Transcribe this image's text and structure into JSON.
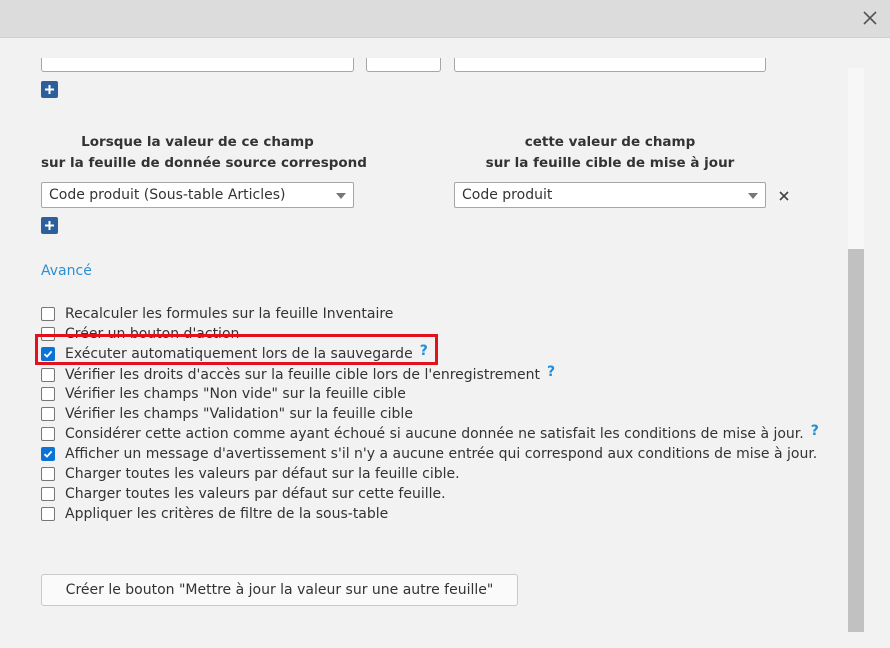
{
  "section_headers": {
    "source_line1": "Lorsque la valeur de ce champ",
    "source_line2": "sur la feuille de donnée source correspond",
    "target_line1": "cette valeur de champ",
    "target_line2": "sur la feuille cible de mise à jour"
  },
  "mapping": {
    "source_value": "Code produit (Sous-table Articles)",
    "target_value": "Code produit"
  },
  "advanced_link": "Avancé",
  "options": [
    {
      "label": "Recalculer les formules sur la feuille Inventaire",
      "checked": false,
      "help": false
    },
    {
      "label": "Créer un bouton d'action",
      "checked": false,
      "help": false
    },
    {
      "label": "Exécuter automatiquement lors de la sauvegarde",
      "checked": true,
      "help": true
    },
    {
      "label": "Vérifier les droits d'accès sur la feuille cible lors de l'enregistrement",
      "checked": false,
      "help": true
    },
    {
      "label": "Vérifier les champs \"Non vide\" sur la feuille cible",
      "checked": false,
      "help": false
    },
    {
      "label": "Vérifier les champs \"Validation\" sur la feuille cible",
      "checked": false,
      "help": false
    },
    {
      "label": "Considérer cette action comme ayant échoué si aucune donnée ne satisfait les conditions de mise à jour.",
      "checked": false,
      "help": true
    },
    {
      "label": "Afficher un message d'avertissement s'il n'y a aucune entrée qui correspond aux conditions de mise à jour.",
      "checked": true,
      "help": false
    },
    {
      "label": "Charger toutes les valeurs par défaut sur la feuille cible.",
      "checked": false,
      "help": false
    },
    {
      "label": "Charger toutes les valeurs par défaut sur cette feuille.",
      "checked": false,
      "help": false
    },
    {
      "label": "Appliquer les critères de filtre de la sous-table",
      "checked": false,
      "help": false
    }
  ],
  "help_symbol": "?",
  "create_button_label": "Créer le bouton \"Mettre à jour la valeur sur une autre feuille\"",
  "colors": {
    "accent": "#0b72d6",
    "link": "#2c8fd6",
    "highlight": "#e3101e",
    "plus_button": "#2d5f9a"
  }
}
